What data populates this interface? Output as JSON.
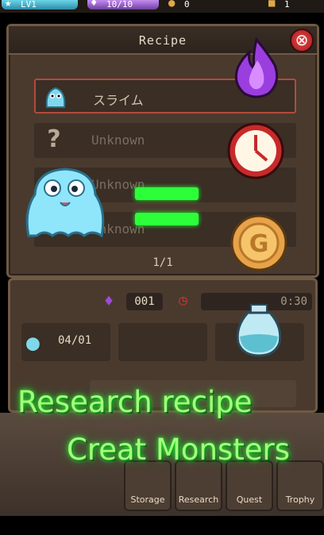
{
  "topbar": {
    "level": "LV1",
    "mana": "10/10",
    "gold": "0",
    "trophies": "1"
  },
  "panel": {
    "title": "Recipe",
    "close_label": "⊗"
  },
  "recipes": [
    {
      "label": "スライム",
      "icon": "slime-icon",
      "active": true
    },
    {
      "label": "Unknown",
      "icon": "question-icon",
      "active": false
    },
    {
      "label": "Unknown",
      "icon": "",
      "active": false
    },
    {
      "label": "Unknown",
      "icon": "",
      "active": false
    }
  ],
  "pager": "1/1",
  "craft": {
    "mana_cost": "001",
    "time_cost": "0:30",
    "potion_count": "04/01"
  },
  "nav": {
    "storage": "Storage",
    "research": "Research",
    "quest": "Quest",
    "trophy": "Trophy"
  },
  "promo": {
    "line1": "Research recipe",
    "line2": "Creat Monsters"
  },
  "colors": {
    "promo_green": "#a4ff7a",
    "panel_brown": "#4a3a2e",
    "close_red": "#d33030"
  }
}
